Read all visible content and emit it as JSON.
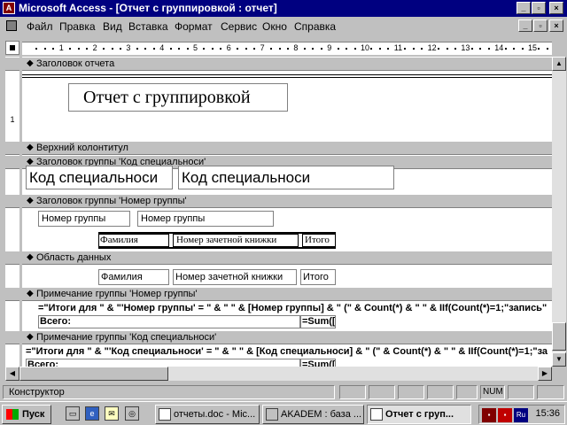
{
  "window": {
    "title": "Microsoft Access - [Отчет с группировкой : отчет]",
    "app_icon": "access-icon"
  },
  "menu": {
    "items": [
      "Файл",
      "Правка",
      "Вид",
      "Вставка",
      "Формат",
      "Сервис",
      "Окно",
      "Справка"
    ]
  },
  "ruler": {
    "ticks": [
      "1",
      "2",
      "3",
      "4",
      "5",
      "6",
      "7",
      "8",
      "9",
      "10",
      "11",
      "12",
      "13",
      "14",
      "15"
    ]
  },
  "vruler": {
    "mark": "1"
  },
  "sections": {
    "report_header": "Заголовок отчета",
    "page_header": "Верхний колонтитул",
    "group_header_spec": "Заголовок группы 'Код специальноси'",
    "group_header_group": "Заголовок группы 'Номер группы'",
    "detail": "Область данных",
    "group_footer_group": "Примечание группы 'Номер группы'",
    "group_footer_spec": "Примечание группы 'Код специальноси'"
  },
  "controls": {
    "report_title": "Отчет с группировкой",
    "spec_label": "Код специальноси",
    "spec_field": "Код специальноси",
    "group_label": "Номер группы",
    "group_field": "Номер группы",
    "col_surname": "Фамилия",
    "col_book": "Номер зачетной книжки",
    "col_total": "Итого",
    "det_surname": "Фамилия",
    "det_book": "Номер зачетной книжки",
    "det_total": "Итого",
    "footer_group_expr": "=\"Итоги для \" & \"'Номер группы' = \" & \" \" & [Номер группы] & \" (\" & Count(*) & \" \" & IIf(Count(*)=1;\"запись\"",
    "footer_group_total_label": "Всего:",
    "footer_group_sum": "=Sum([",
    "footer_spec_expr": "=\"Итоги для \" & \"'Код специальноси' = \" & \" \" & [Код специальноси] & \" (\" & Count(*) & \" \" & IIf(Count(*)=1;\"за",
    "footer_spec_total_label": "Всего:",
    "footer_spec_sum": "=Sum(["
  },
  "status": {
    "text": "Конструктор",
    "num": "NUM"
  },
  "taskbar": {
    "start": "Пуск",
    "tasks": [
      "отчеты.doc - Mic...",
      "AKADEM : база ...",
      "Отчет с груп..."
    ],
    "clock": "15:36",
    "lang": "Ru"
  }
}
